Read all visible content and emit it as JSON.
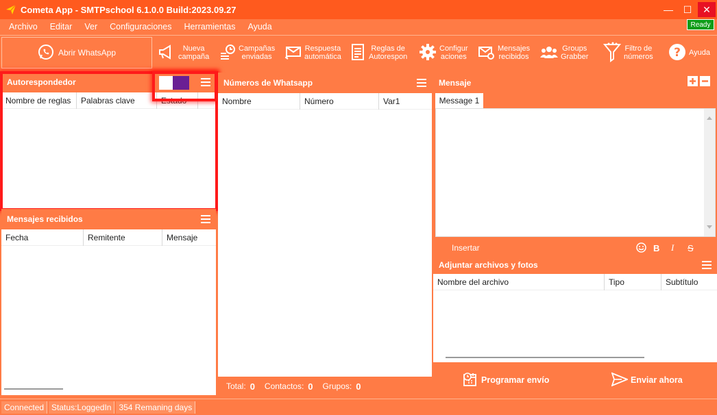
{
  "window": {
    "title": "Cometa App - SMTPschool 6.1.0.0 Build:2023.09.27",
    "controls": {
      "minimize": "—",
      "maximize": "☐",
      "close": "✕"
    }
  },
  "menu": {
    "items": [
      "Archivo",
      "Editar",
      "Ver",
      "Configuraciones",
      "Herramientas",
      "Ayuda"
    ],
    "ready": "Ready"
  },
  "toolbar": {
    "open_whatsapp": "Abrir WhatsApp",
    "buttons": [
      {
        "icon": "megaphone-icon",
        "label": "Nueva\ncampaña"
      },
      {
        "icon": "clock-list-icon",
        "label": "Campañas\nenviadas"
      },
      {
        "icon": "mail-reply-icon",
        "label": "Respuesta\nautomática"
      },
      {
        "icon": "document-list-icon",
        "label": "Reglas de\nAutorespon"
      },
      {
        "icon": "gear-icon",
        "label": "Configur\naciones"
      },
      {
        "icon": "mail-check-icon",
        "label": "Mensajes\nrecibidos"
      },
      {
        "icon": "group-icon",
        "label": "Groups\nGrabber"
      },
      {
        "icon": "filter-icon",
        "label": "Filtro de\nnúmeros"
      },
      {
        "icon": "help-icon",
        "label": "Ayuda"
      }
    ]
  },
  "autoresponder": {
    "title": "Autorespondedor",
    "columns": [
      "Nombre de reglas",
      "Palabras clave",
      "Estado"
    ]
  },
  "received": {
    "title": "Mensajes recibidos",
    "columns": [
      "Fecha",
      "Remitente",
      "Mensaje"
    ]
  },
  "numbers": {
    "title": "Números de Whatsapp",
    "columns": [
      "Nombre",
      "Número",
      "Var1"
    ],
    "total_label": "Total:",
    "total_value": "0",
    "contacts_label": "Contactos:",
    "contacts_value": "0",
    "groups_label": "Grupos:",
    "groups_value": "0"
  },
  "message": {
    "title": "Mensaje",
    "tab": "Message 1",
    "insert": "Insertar",
    "bold": "B",
    "italic": "I",
    "strike": "S"
  },
  "attachments": {
    "title": "Adjuntar archivos y fotos",
    "columns": [
      "Nombre del archivo",
      "Tipo",
      "Subtítulo"
    ]
  },
  "actions": {
    "schedule": "Programar envío",
    "send_now": "Enviar ahora"
  },
  "status": {
    "connected": "Connected",
    "status": "Status:LoggedIn",
    "remaining": "354 Remaning days"
  },
  "colors": {
    "accent": "#ff7b45",
    "titlebar": "#ff5a1e",
    "toggle_purple": "#6a1f94",
    "highlight": "#ff1a1a"
  }
}
